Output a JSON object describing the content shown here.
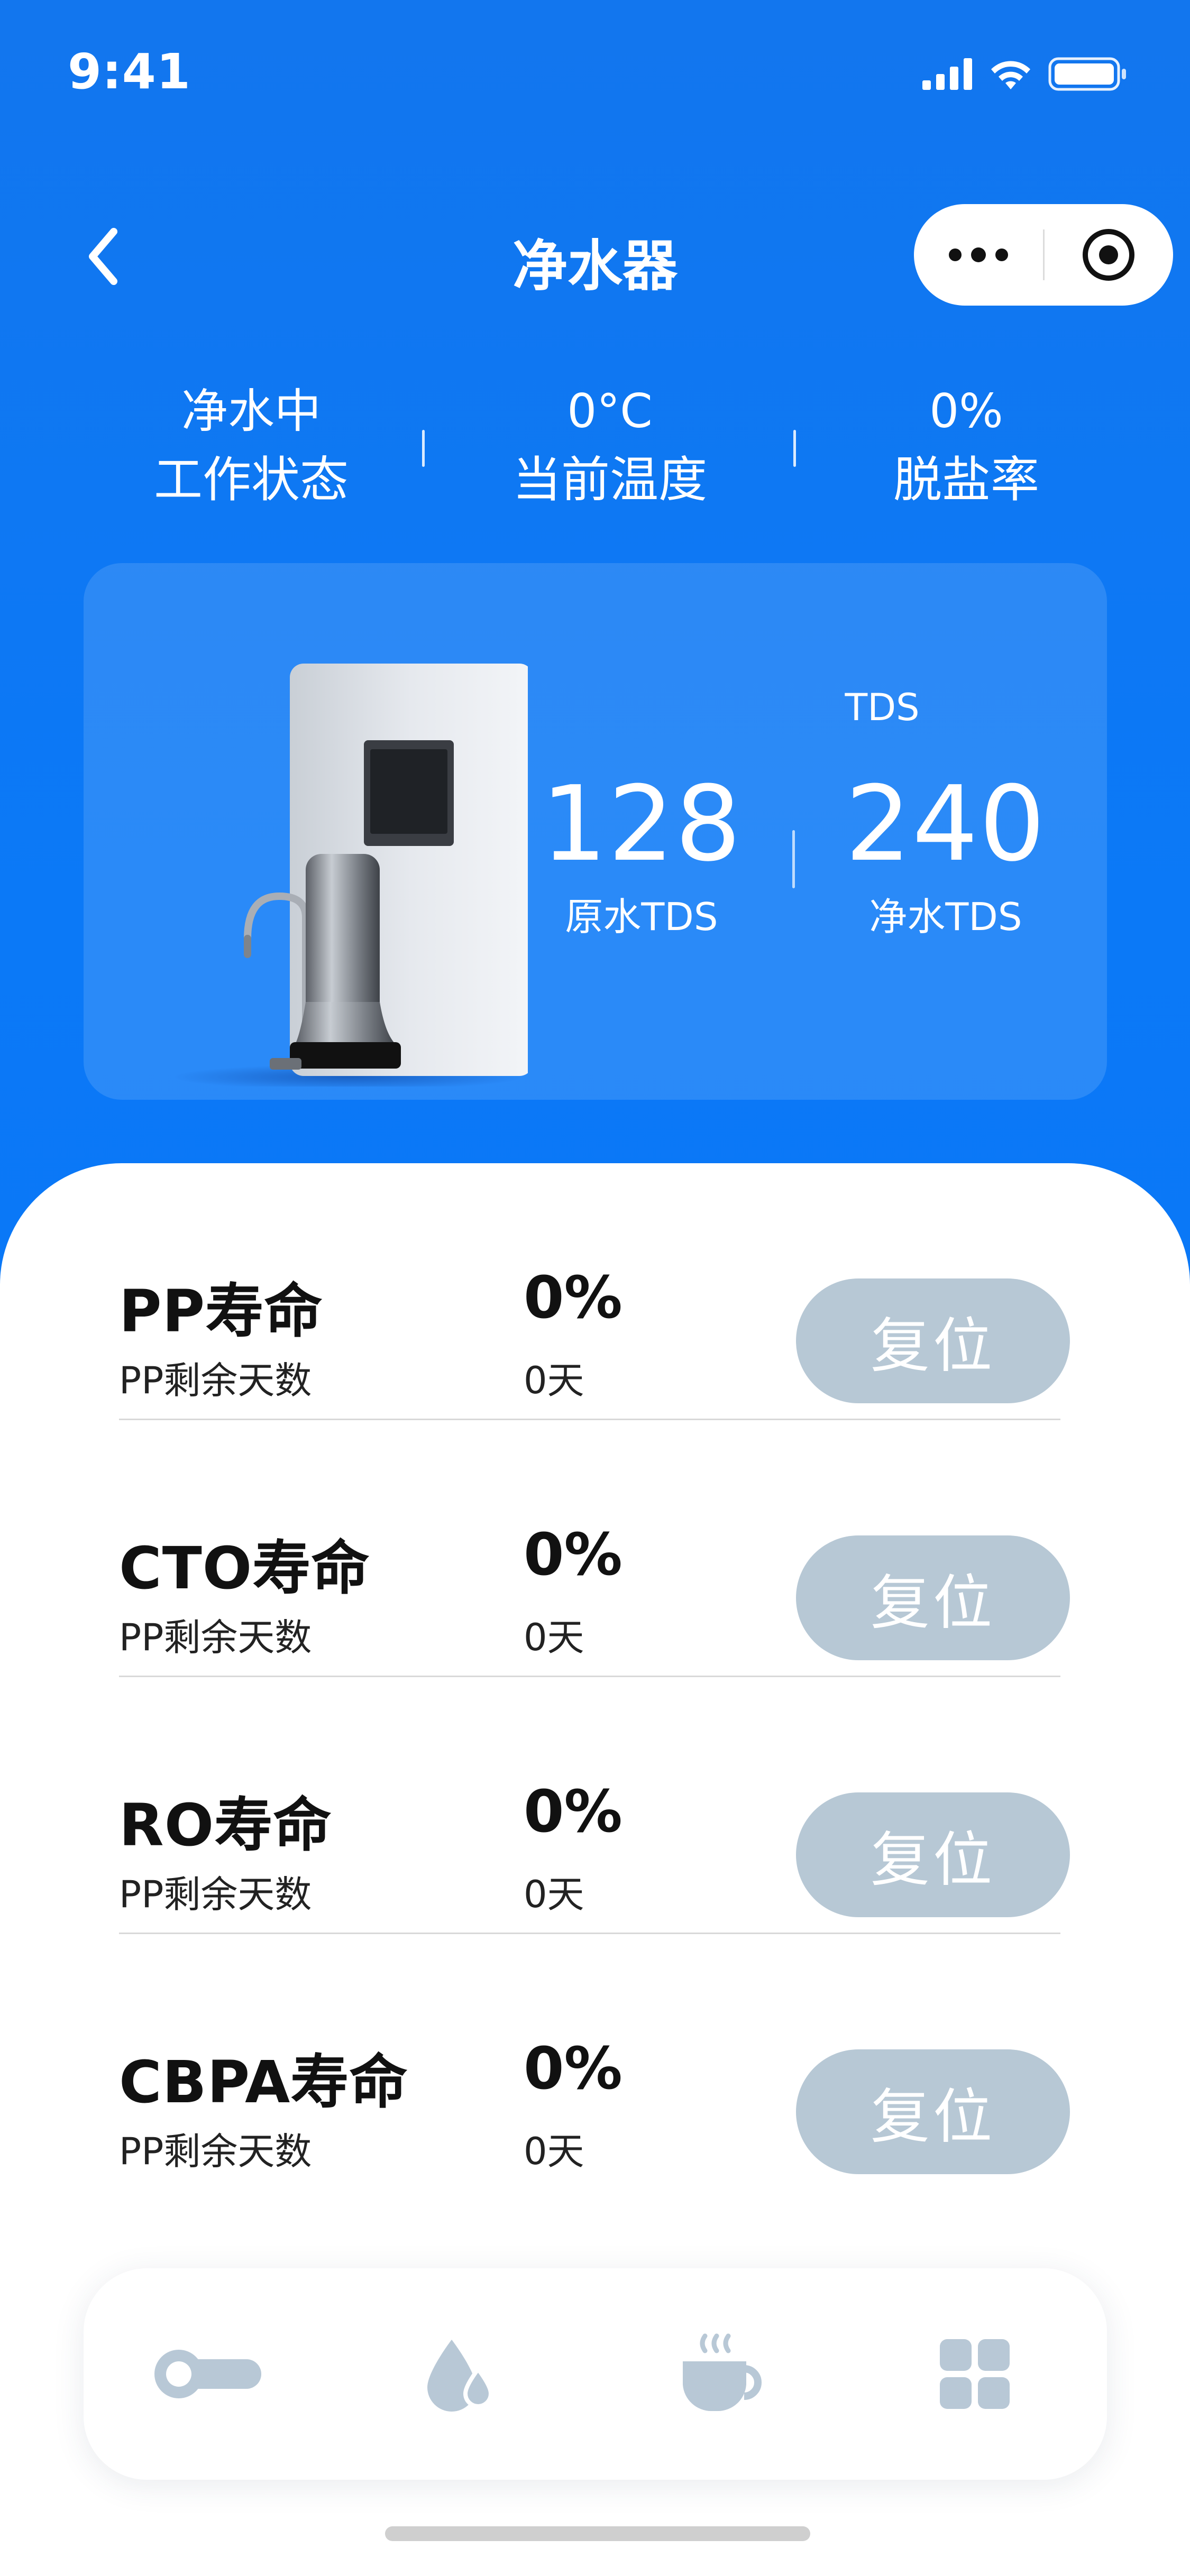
{
  "status_bar": {
    "time": "9:41"
  },
  "nav": {
    "title": "净水器"
  },
  "stats": [
    {
      "value": "净水中",
      "label": "工作状态"
    },
    {
      "value": "0°C",
      "label": "当前温度"
    },
    {
      "value": "0%",
      "label": "脱盐率"
    }
  ],
  "tds": {
    "label": "TDS",
    "raw_value": "128",
    "raw_label": "原水TDS",
    "pure_value": "240",
    "pure_label": "净水TDS"
  },
  "filters": [
    {
      "name": "PP寿命",
      "sub": "PP剩余天数",
      "percent": "0%",
      "days": "0天",
      "reset": "复位"
    },
    {
      "name": "CTO寿命",
      "sub": "PP剩余天数",
      "percent": "0%",
      "days": "0天",
      "reset": "复位"
    },
    {
      "name": "RO寿命",
      "sub": "PP剩余天数",
      "percent": "0%",
      "days": "0天",
      "reset": "复位"
    },
    {
      "name": "CBPA寿命",
      "sub": "PP剩余天数",
      "percent": "0%",
      "days": "0天",
      "reset": "复位"
    }
  ],
  "tabs": [
    {
      "icon": "toggle-icon"
    },
    {
      "icon": "water-drop-icon"
    },
    {
      "icon": "coffee-cup-icon"
    },
    {
      "icon": "grid-icon"
    }
  ],
  "colors": {
    "header_blue": "#0a77f7",
    "reset_button": "#b7c8d5",
    "tab_icon": "#b8c8d6"
  }
}
